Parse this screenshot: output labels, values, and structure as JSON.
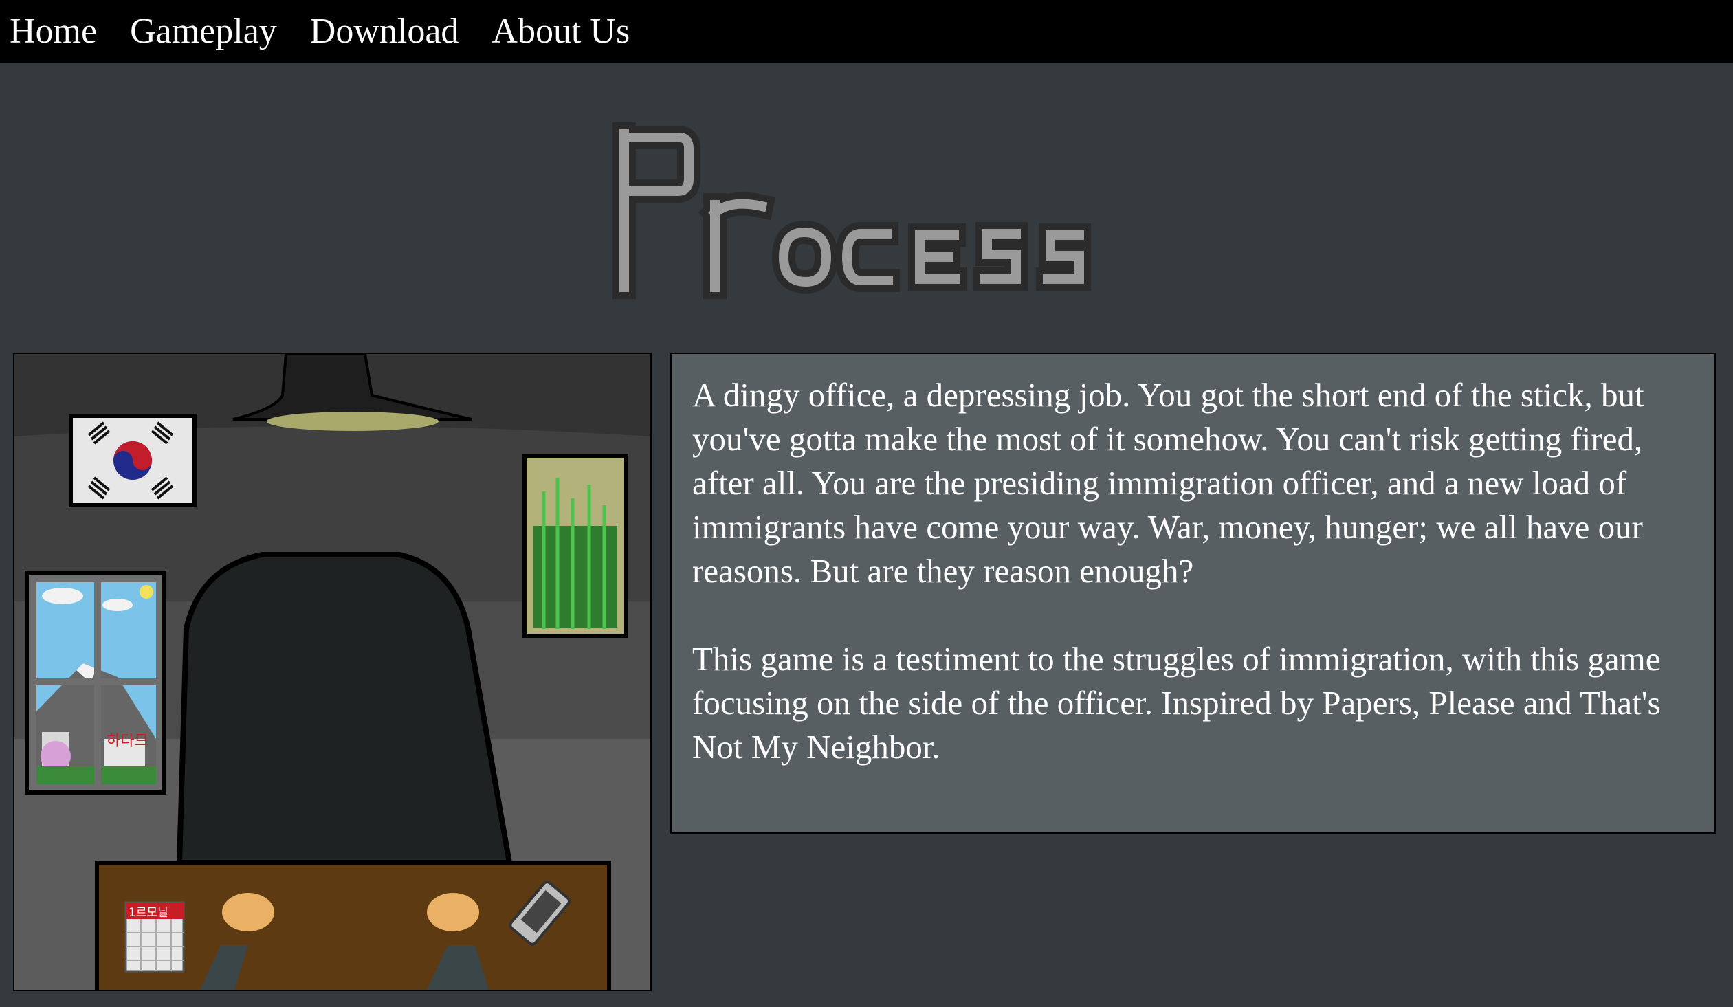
{
  "nav": {
    "links": [
      "Home",
      "Gameplay",
      "Download",
      "About Us"
    ]
  },
  "header": {
    "title": "Process"
  },
  "carousel": {
    "prev_symbol": "‹",
    "next_symbol": "›",
    "calendar_text": "1르모닐",
    "poster_text": "하다므"
  },
  "description": {
    "paragraphs": [
      "A dingy office, a depressing job. You got the short end of the stick, but you've gotta make the most of it somehow. You can't risk getting fired, after all. You are the presiding immigration officer, and a new load of immigrants have come your way. War, money, hunger; we all have our reasons. But are they reason enough?",
      "This game is a testiment to the struggles of immigration, with this game focusing on the side of the officer. Inspired by Papers, Please and That's Not My Neighbor."
    ]
  },
  "colors": {
    "page_bg": "#353a3e",
    "nav_bg": "#000000",
    "panel_bg": "#575f63",
    "title_fill": "#9a9a9a",
    "title_outline": "#2b2b2b"
  }
}
